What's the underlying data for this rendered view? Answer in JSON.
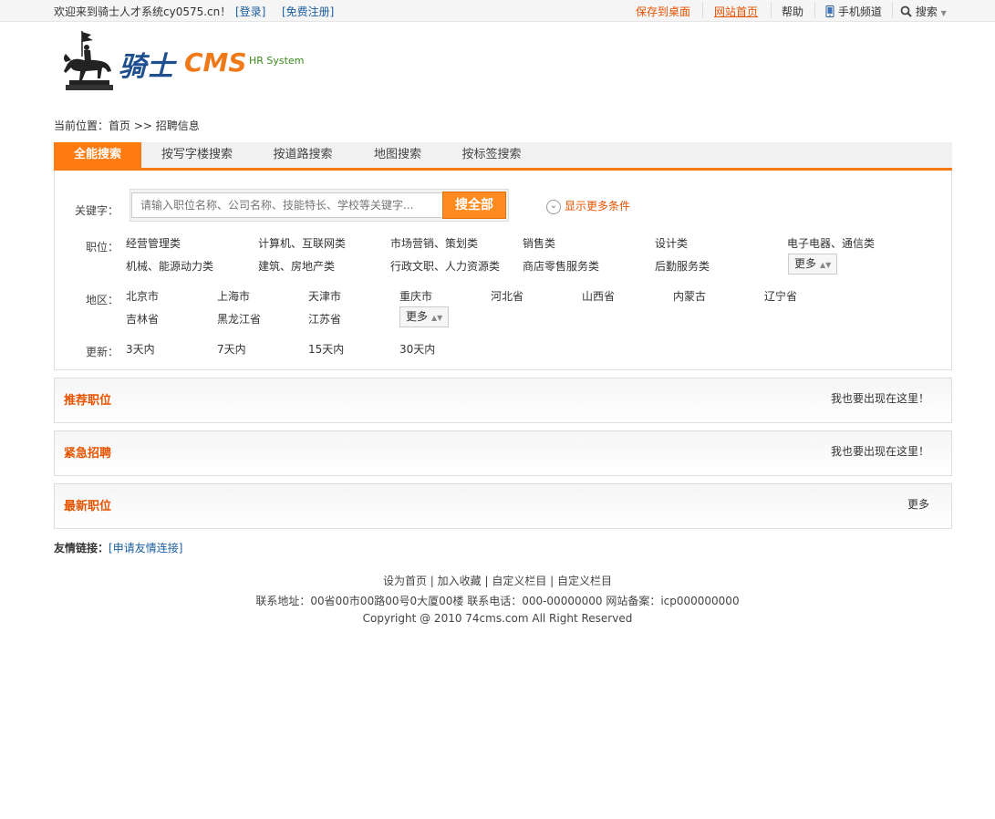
{
  "topbar": {
    "welcome": "欢迎来到骑士人才系统cy0575.cn！",
    "login": "[登录]",
    "register": "[免费注册]",
    "save_desktop": "保存到桌面",
    "site_home": "网站首页",
    "help": "帮助",
    "mobile": "手机频道",
    "search": "搜索"
  },
  "logo": {
    "cn": "骑士",
    "en": "CMS",
    "sub": "HR System"
  },
  "breadcrumb": "当前位置：首页 >> 招聘信息",
  "tabs": [
    "全能搜索",
    "按写字楼搜索",
    "按道路搜索",
    "地图搜索",
    "按标签搜索"
  ],
  "search": {
    "keyword_label": "关键字：",
    "placeholder": "请输入职位名称、公司名称、技能特长、学校等关键字...",
    "button": "搜全部",
    "more_conditions": "显示更多条件"
  },
  "jobs": {
    "label": "职位：",
    "items": [
      "经营管理类",
      "计算机、互联网类",
      "市场营销、策划类",
      "销售类",
      "设计类",
      "电子电器、通信类",
      "机械、能源动力类",
      "建筑、房地产类",
      "行政文职、人力资源类",
      "商店零售服务类",
      "后勤服务类"
    ],
    "more": "更多"
  },
  "areas": {
    "label": "地区：",
    "items": [
      "北京市",
      "上海市",
      "天津市",
      "重庆市",
      "河北省",
      "山西省",
      "内蒙古",
      "辽宁省",
      "吉林省",
      "黑龙江省",
      "江苏省"
    ],
    "more": "更多"
  },
  "updates": {
    "label": "更新：",
    "items": [
      "3天内",
      "7天内",
      "15天内",
      "30天内"
    ]
  },
  "panels": [
    {
      "title": "推荐职位",
      "right": "我也要出现在这里！"
    },
    {
      "title": "紧急招聘",
      "right": "我也要出现在这里！"
    },
    {
      "title": "最新职位",
      "right": "更多"
    }
  ],
  "friend_links": {
    "label": "友情链接：",
    "link": "[申请友情连接]"
  },
  "footer": {
    "links": "设为首页 | 加入收藏  | 自定义栏目 | 自定义栏目",
    "contact": "联系地址：00省00市00路00号0大厦00楼 联系电话：000-00000000 网站备案：icp000000000",
    "copyright": "Copyright @ 2010 74cms.com All Right Reserved"
  },
  "colors": {
    "accent": "#ff7a0f",
    "link": "#1c5ea0",
    "title_orange": "#e65300"
  }
}
